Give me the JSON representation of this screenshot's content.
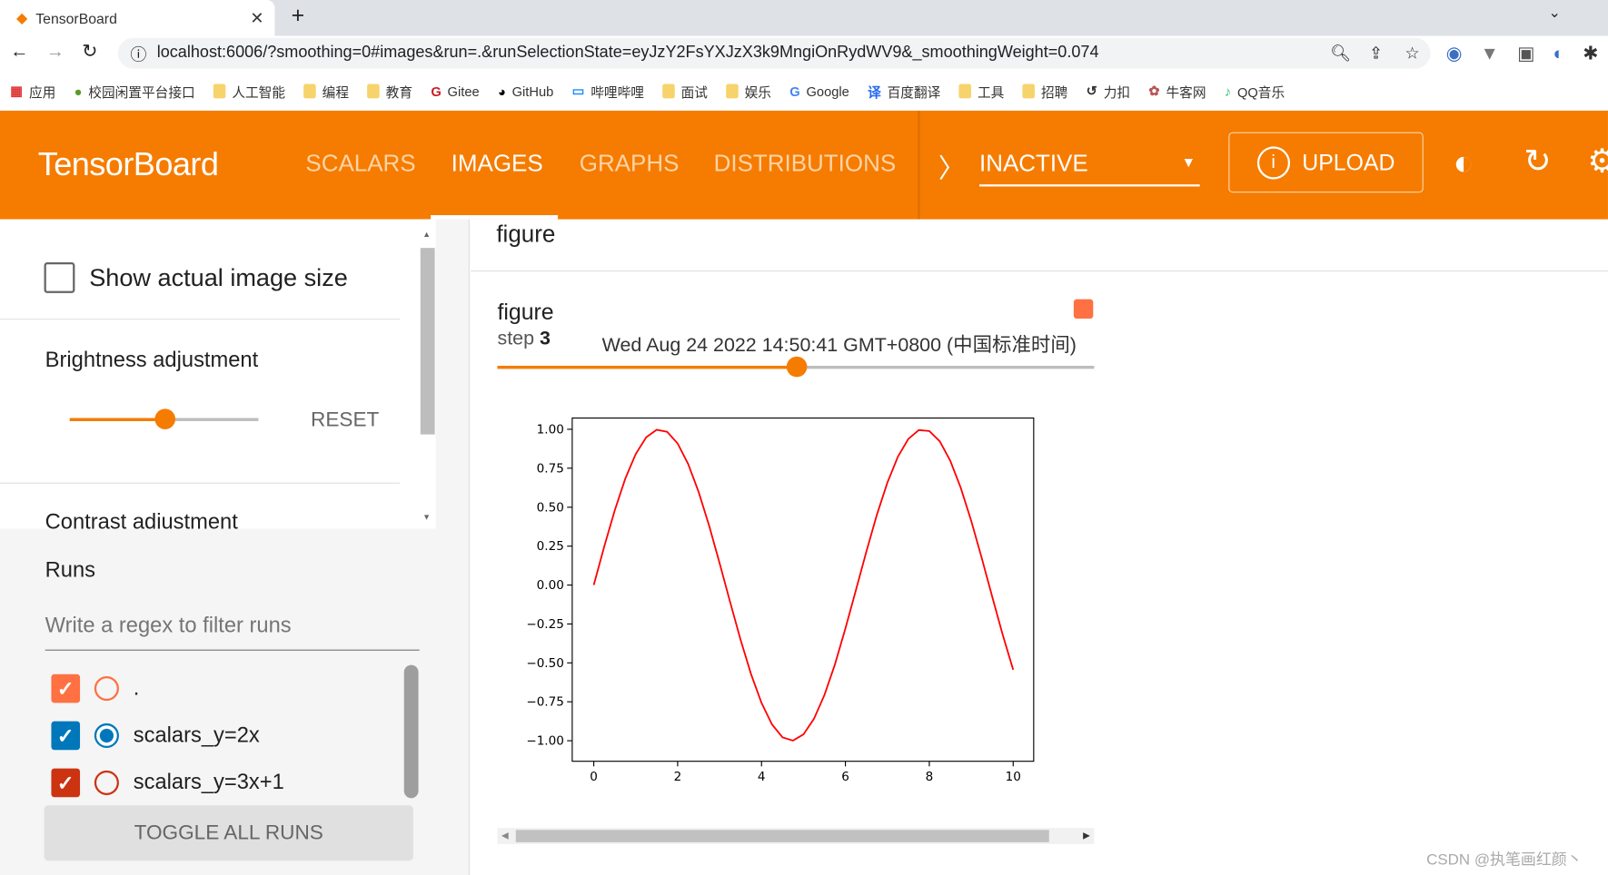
{
  "browser": {
    "tab_title": "TensorBoard",
    "url": "localhost:6006/?smoothing=0#images&run=.&runSelectionState=eyJzY2FsYXJzX3k9MngiOnRydWV9&_smoothingWeight=0.074",
    "bookmarks": [
      "应用",
      "校园闲置平台接口",
      "人工智能",
      "编程",
      "教育",
      "Gitee",
      "GitHub",
      "哔哩哔哩",
      "面试",
      "娱乐",
      "Google",
      "百度翻译",
      "工具",
      "招聘",
      "力扣",
      "牛客网",
      "QQ音乐"
    ]
  },
  "header": {
    "brand": "TensorBoard",
    "tabs": [
      "SCALARS",
      "IMAGES",
      "GRAPHS",
      "DISTRIBUTIONS"
    ],
    "active_tab": "IMAGES",
    "run_status": "INACTIVE",
    "upload": "UPLOAD",
    "accent": "#f57c00"
  },
  "sidebar": {
    "show_actual_size": "Show actual image size",
    "brightness": "Brightness adjustment",
    "brightness_level": 0.5,
    "reset": "RESET",
    "contrast": "Contrast adjustment",
    "runs_title": "Runs",
    "filter_placeholder": "Write a regex to filter runs",
    "runs": [
      {
        "name": ".",
        "checked": true,
        "selected": false,
        "color": "#ff7043"
      },
      {
        "name": "scalars_y=2x",
        "checked": true,
        "selected": true,
        "color": "#0077bb"
      },
      {
        "name": "scalars_y=3x+1",
        "checked": true,
        "selected": false,
        "color": "#cc3311"
      }
    ],
    "toggle_all": "TOGGLE ALL RUNS"
  },
  "main": {
    "group_title": "figure",
    "card": {
      "title": "figure",
      "step_label": "step",
      "step": "3",
      "timestamp": "Wed Aug 24 2022 14:50:41 GMT+0800 (中国标准时间)",
      "step_progress": 0.5
    }
  },
  "watermark": "CSDN @执笔画红颜丶",
  "chart_data": {
    "type": "line",
    "xlim": [
      0,
      10
    ],
    "ylim": [
      -1,
      1
    ],
    "xticks": [
      "0",
      "2",
      "4",
      "6",
      "8",
      "10"
    ],
    "yticks": [
      "1.00",
      "0.75",
      "0.50",
      "0.25",
      "0.00",
      "−0.25",
      "−0.50",
      "−0.75",
      "−1.00"
    ],
    "color": "#ff0000",
    "x": [
      0,
      0.25,
      0.5,
      0.75,
      1,
      1.25,
      1.5,
      1.75,
      2,
      2.25,
      2.5,
      2.75,
      3,
      3.25,
      3.5,
      3.75,
      4,
      4.25,
      4.5,
      4.75,
      5,
      5.25,
      5.5,
      5.75,
      6,
      6.25,
      6.5,
      6.75,
      7,
      7.25,
      7.5,
      7.75,
      8,
      8.25,
      8.5,
      8.75,
      9,
      9.25,
      9.5,
      9.75,
      10
    ],
    "y": [
      0,
      0.247,
      0.479,
      0.682,
      0.841,
      0.949,
      0.997,
      0.984,
      0.909,
      0.778,
      0.598,
      0.382,
      0.141,
      -0.108,
      -0.351,
      -0.572,
      -0.757,
      -0.895,
      -0.978,
      -0.999,
      -0.959,
      -0.859,
      -0.706,
      -0.51,
      -0.279,
      -0.033,
      0.215,
      0.451,
      0.657,
      0.823,
      0.938,
      0.995,
      0.989,
      0.923,
      0.798,
      0.624,
      0.412,
      0.174,
      -0.075,
      -0.319,
      -0.544
    ]
  }
}
